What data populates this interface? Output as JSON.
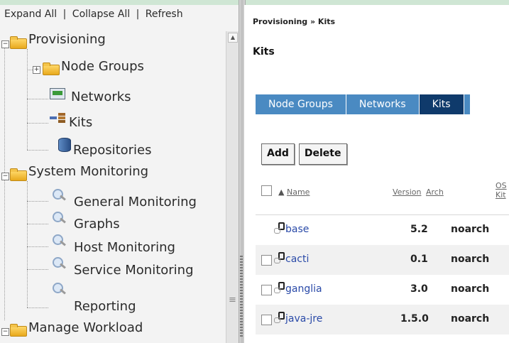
{
  "toolbar": {
    "expand_all": "Expand All",
    "collapse_all": "Collapse All",
    "refresh": "Refresh",
    "separator": "|"
  },
  "tree": {
    "provisioning": "Provisioning",
    "node_groups": "Node Groups",
    "networks": "Networks",
    "kits": "Kits",
    "repositories": "Repositories",
    "system_monitoring": "System Monitoring",
    "general_monitoring": "General Monitoring",
    "graphs": "Graphs",
    "host_monitoring": "Host Monitoring",
    "service_monitoring": "Service Monitoring",
    "reporting": "Reporting",
    "manage_workload": "Manage Workload"
  },
  "content": {
    "breadcrumb": "Provisioning » Kits",
    "page_title": "Kits",
    "tabs": [
      {
        "label": "Node Groups"
      },
      {
        "label": "Networks"
      },
      {
        "label": "Kits",
        "active": true
      }
    ],
    "buttons": {
      "add": "Add",
      "delete": "Delete"
    },
    "table": {
      "columns": {
        "name": "Name",
        "version": "Version",
        "arch": "Arch",
        "os_line1": "OS",
        "os_line2": "Kit"
      },
      "sort_indicator": "▲",
      "rows": [
        {
          "name": "base",
          "version": "5.2",
          "arch": "noarch",
          "checkbox": false
        },
        {
          "name": "cacti",
          "version": "0.1",
          "arch": "noarch",
          "checkbox": true
        },
        {
          "name": "ganglia",
          "version": "3.0",
          "arch": "noarch",
          "checkbox": true
        },
        {
          "name": "java-jre",
          "version": "1.5.0",
          "arch": "noarch",
          "checkbox": true
        }
      ]
    }
  },
  "colors": {
    "tab_blue": "#4a8ac2",
    "tab_active": "#0f3a6b",
    "link_blue": "#2a4aa8",
    "frame_green": "#e6f2ea"
  },
  "icons": {
    "folder": "folder-icon",
    "network": "network-icon",
    "kits": "kits-icon",
    "repository": "repository-icon",
    "monitoring": "magnifier-icon",
    "kit_row": "kit-package-icon"
  }
}
